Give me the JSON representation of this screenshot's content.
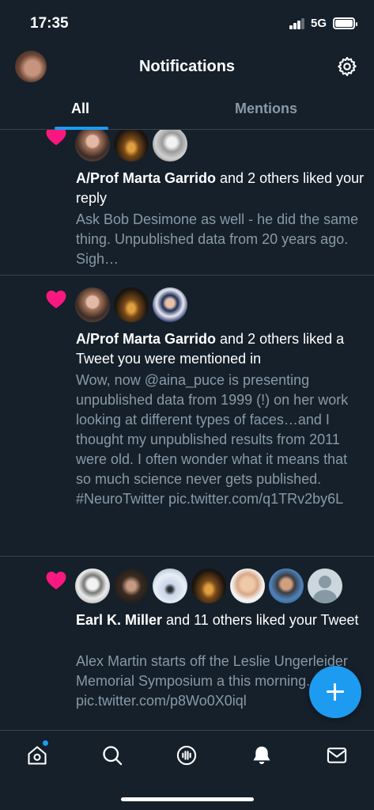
{
  "status_bar": {
    "time": "17:35",
    "network": "5G"
  },
  "header": {
    "title": "Notifications"
  },
  "tabs": [
    {
      "label": "All",
      "selected": true
    },
    {
      "label": "Mentions",
      "selected": false
    }
  ],
  "notifications": [
    {
      "actor": "A/Prof Marta Garrido",
      "action": " and 2 others liked your reply",
      "text": "Ask Bob Desimone as well - he did the same thing. Unpublished data from 20 years ago. Sigh…"
    },
    {
      "actor": "A/Prof Marta Garrido",
      "action": " and 2 others liked a Tweet you were mentioned in",
      "text": "Wow, now @aina_puce is presenting unpublished data from 1999 (!) on her work looking at different types of faces…and I thought my unpublished results from 2011 were old. I often wonder what it means that so much science never gets published. #NeuroTwitter pic.twitter.com/q1TRv2by6L"
    },
    {
      "actor": "Earl K. Miller",
      "action": " and 11 others liked your Tweet",
      "text": "Alex Martin starts off the Leslie Ungerleider Memorial Symposium a this morning. pic.twitter.com/p8Wo0X0iql"
    }
  ],
  "icons": {
    "heart": "heart-icon",
    "settings": "gear-icon",
    "compose": "plus-icon",
    "nav": [
      "home-icon",
      "search-icon",
      "spaces-icon",
      "bell-icon",
      "mail-icon"
    ]
  },
  "colors": {
    "background": "#15202b",
    "accent": "#1d9bf0",
    "like": "#f91880",
    "muted_text": "#8899a6",
    "divider": "#38444d"
  }
}
